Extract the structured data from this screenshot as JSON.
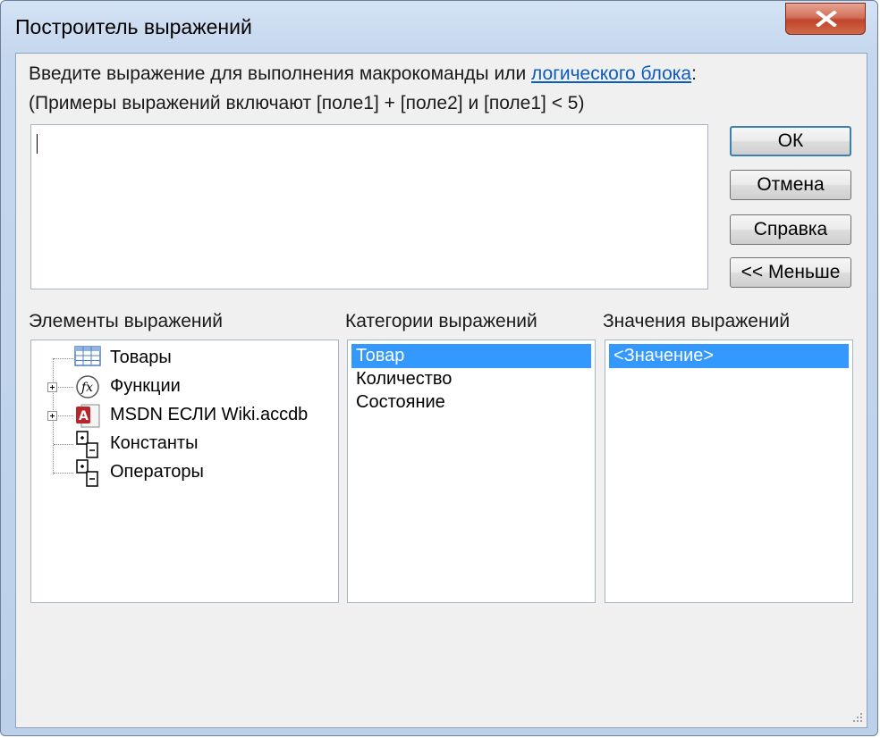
{
  "window": {
    "title": "Построитель выражений",
    "close_icon": "close-x-icon"
  },
  "prompt": {
    "line1_prefix": "Введите выражение для выполнения макрокоманды или ",
    "line1_link": "логического блока",
    "line1_suffix": ":",
    "line2": "(Примеры выражений включают [поле1] + [поле2] и [поле1] < 5)"
  },
  "expression_input": {
    "value": ""
  },
  "buttons": {
    "ok": "ОК",
    "cancel": "Отмена",
    "help": "Справка",
    "less": "<< Меньше"
  },
  "elements_panel": {
    "label": "Элементы выражений",
    "items": [
      {
        "label": "Товары",
        "icon": "table-icon",
        "expandable": false
      },
      {
        "label": "Функции",
        "icon": "function-icon",
        "expandable": true
      },
      {
        "label": "MSDN ЕСЛИ Wiki.accdb",
        "icon": "access-database-icon",
        "expandable": true
      },
      {
        "label": "Константы",
        "icon": "constants-icon",
        "expandable": false
      },
      {
        "label": "Операторы",
        "icon": "operators-icon",
        "expandable": false
      }
    ]
  },
  "categories_panel": {
    "label": "Категории выражений",
    "items": [
      "Товар",
      "Количество",
      "Состояние"
    ],
    "selected": "Товар"
  },
  "values_panel": {
    "label": "Значения выражений",
    "items": [
      "<Значение>"
    ],
    "selected": "<Значение>"
  },
  "colors": {
    "selection": "#3399ff",
    "link": "#0a5cc2",
    "close_button": "#c0442c"
  }
}
